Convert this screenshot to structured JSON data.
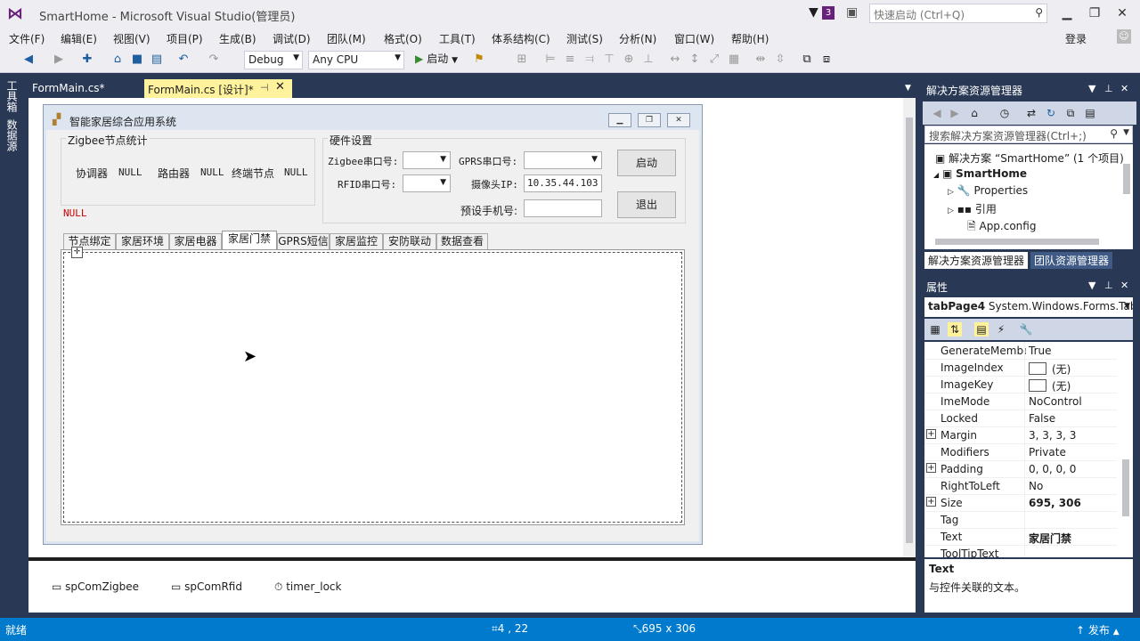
{
  "window": {
    "title": "SmartHome - Microsoft Visual Studio(管理员)",
    "notification_count": "3",
    "quick_launch_placeholder": "快速启动 (Ctrl+Q)",
    "login": "登录"
  },
  "menu": [
    "文件(F)",
    "编辑(E)",
    "视图(V)",
    "项目(P)",
    "生成(B)",
    "调试(D)",
    "团队(M)",
    "格式(O)",
    "工具(T)",
    "体系结构(C)",
    "测试(S)",
    "分析(N)",
    "窗口(W)",
    "帮助(H)"
  ],
  "toolbar": {
    "config": "Debug",
    "platform": "Any CPU",
    "start": "启动"
  },
  "left_strip": [
    "工具箱",
    "数据源"
  ],
  "doc_tabs": [
    {
      "label": "FormMain.cs*",
      "active": false
    },
    {
      "label": "FormMain.cs [设计]*",
      "active": true
    }
  ],
  "form": {
    "title": "智能家居综合应用系统",
    "zigbee_group": "Zigbee节点统计",
    "coordinator_label": "协调器",
    "coordinator_value": "NULL",
    "router_label": "路由器",
    "router_value": "NULL",
    "end_node_label": "终端节点",
    "end_node_value": "NULL",
    "status_text": "NULL",
    "hardware_group": "硬件设置",
    "zigbee_port_label": "Zigbee串口号:",
    "gprs_port_label": "GPRS串口号:",
    "rfid_port_label": "RFID串口号:",
    "camera_ip_label": "摄像头IP:",
    "camera_ip_value": "10.35.44.103",
    "phone_label": "预设手机号:",
    "phone_value": "",
    "start_button": "启动",
    "exit_button": "退出",
    "tabs": [
      "节点绑定",
      "家居环境",
      "家居电器",
      "家居门禁",
      "GPRS短信",
      "家居监控",
      "安防联动",
      "数据查看"
    ],
    "active_tab": 3
  },
  "tray": [
    "spComZigbee",
    "spComRfid",
    "timer_lock"
  ],
  "solution_explorer": {
    "title": "解决方案资源管理器",
    "search_placeholder": "搜索解决方案资源管理器(Ctrl+;)",
    "items": [
      "解决方案 “SmartHome” (1 个项目)",
      "SmartHome",
      "Properties",
      "引用",
      "App.config"
    ],
    "tabs": [
      "解决方案资源管理器",
      "团队资源管理器"
    ]
  },
  "properties": {
    "title": "属性",
    "object_name": "tabPage4",
    "object_type": "System.Windows.Forms.TabPage",
    "rows": [
      {
        "name": "GenerateMember",
        "value": "True",
        "expand": false,
        "bold": false,
        "img": false
      },
      {
        "name": "ImageIndex",
        "value": "(无)",
        "expand": false,
        "bold": false,
        "img": true
      },
      {
        "name": "ImageKey",
        "value": "(无)",
        "expand": false,
        "bold": false,
        "img": true
      },
      {
        "name": "ImeMode",
        "value": "NoControl",
        "expand": false,
        "bold": false,
        "img": false
      },
      {
        "name": "Locked",
        "value": "False",
        "expand": false,
        "bold": false,
        "img": false
      },
      {
        "name": "Margin",
        "value": "3, 3, 3, 3",
        "expand": true,
        "bold": false,
        "img": false
      },
      {
        "name": "Modifiers",
        "value": "Private",
        "expand": false,
        "bold": false,
        "img": false
      },
      {
        "name": "Padding",
        "value": "0, 0, 0, 0",
        "expand": true,
        "bold": false,
        "img": false
      },
      {
        "name": "RightToLeft",
        "value": "No",
        "expand": false,
        "bold": false,
        "img": false
      },
      {
        "name": "Size",
        "value": "695, 306",
        "expand": true,
        "bold": true,
        "img": false
      },
      {
        "name": "Tag",
        "value": "",
        "expand": false,
        "bold": false,
        "img": false
      },
      {
        "name": "Text",
        "value": "家居门禁",
        "expand": false,
        "bold": true,
        "img": false
      },
      {
        "name": "ToolTipText",
        "value": "",
        "expand": false,
        "bold": false,
        "img": false
      }
    ],
    "desc_title": "Text",
    "desc_text": "与控件关联的文本。"
  },
  "status": {
    "text": "就绪",
    "position": "4 , 22",
    "size": "695 x 306",
    "publish": "发布"
  },
  "colors": {
    "accent": "#007acc",
    "frame": "#293955",
    "active_tab": "#fff29d",
    "status_null": "#cc0000"
  }
}
